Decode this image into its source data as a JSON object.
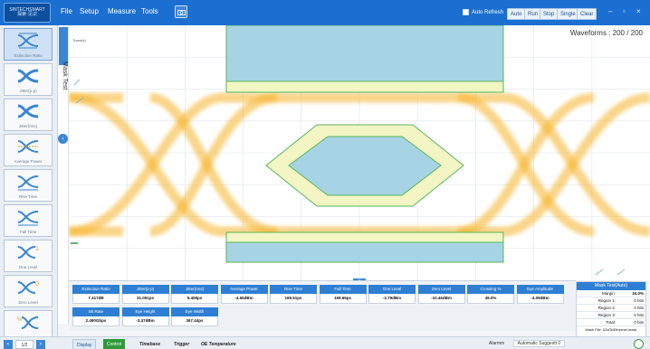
{
  "app": {
    "logo_text": [
      "SINTECHSMART",
      "探索·见识"
    ]
  },
  "menu": [
    "File",
    "Setup",
    "Measure",
    "Tools"
  ],
  "toolbar": {
    "auto_refresh_label": "Auto Refresh",
    "buttons": [
      "Auto",
      "Run",
      "Stop",
      "Single",
      "Clear"
    ],
    "window_minimize": "–",
    "window_restore": "▫",
    "window_close": "×"
  },
  "left_panel": {
    "items": [
      {
        "label": "Extinction Ratio",
        "icon": "eye-er-icon",
        "active": true
      },
      {
        "label": "Jitter(p-p)",
        "icon": "eye-jitter-pp-icon"
      },
      {
        "label": "Jitter(rms)",
        "icon": "eye-jitter-rms-icon"
      },
      {
        "label": "Average Power",
        "icon": "eye-avg-power-icon"
      },
      {
        "label": "Rise Time",
        "icon": "eye-rise-time-icon"
      },
      {
        "label": "Fall Time",
        "icon": "eye-fall-time-icon"
      },
      {
        "label": "One Level",
        "icon": "eye-one-level-icon"
      },
      {
        "label": "Zero Level",
        "icon": "eye-zero-level-icon"
      },
      {
        "label": "Crossing %",
        "icon": "eye-crossing-icon"
      }
    ]
  },
  "side_tab": {
    "label": "Mask Test",
    "collapse_icon": "chevron-left-icon"
  },
  "plot": {
    "waveforms_label": "Waveforms : 200 / 200",
    "tag": "Trace(s)",
    "colors": {
      "eye": "#f5b324",
      "mask_fill": "#a7d4e4",
      "mask_margin": "#f3f5c4",
      "mask_edge": "#57b65a"
    }
  },
  "measurements": {
    "row1": [
      {
        "label": "Extinction Ratio",
        "value": "7.417dB"
      },
      {
        "label": "Jitter(p-p)",
        "value": "31.051ps"
      },
      {
        "label": "Jitter(rms)",
        "value": "5.408ps"
      },
      {
        "label": "Average Power",
        "value": "-4.66dBm"
      },
      {
        "label": "Rise Time",
        "value": "169.51ps"
      },
      {
        "label": "Fall Time",
        "value": "169.65ps"
      },
      {
        "label": "One Level",
        "value": "-2.79dBm"
      },
      {
        "label": "Zero Level",
        "value": "-10.46dBm"
      },
      {
        "label": "Crossing %",
        "value": "49.0%"
      },
      {
        "label": "Eye Amplitude",
        "value": "-4.09dBm"
      }
    ],
    "row2": [
      {
        "label": "Bit Rate",
        "value": "2.490Gbps"
      },
      {
        "label": "Eye Height",
        "value": "-3.47dBm"
      },
      {
        "label": "Eye Width",
        "value": "367.44ps"
      }
    ]
  },
  "mask_result": {
    "title": "Mask Test(Auto)",
    "rows": [
      {
        "k": "Margin:",
        "v": "34.0%"
      },
      {
        "k": "Region 1:",
        "v": "0 hits"
      },
      {
        "k": "Region 2:",
        "v": "0 hits"
      },
      {
        "k": "Region 3:",
        "v": "0 hits"
      },
      {
        "k": "Total:",
        "v": "0 hits"
      }
    ],
    "file": "Mask File: 02xGbEthernet.mask"
  },
  "bottom": {
    "page": "1/2",
    "prev": "<",
    "next": ">",
    "tabs": [
      "Display",
      "Control",
      "Timebase",
      "Trigger",
      "OE Temperature"
    ],
    "status_label": "Alarmm",
    "status_value": "Automatic Suggestt 0"
  }
}
